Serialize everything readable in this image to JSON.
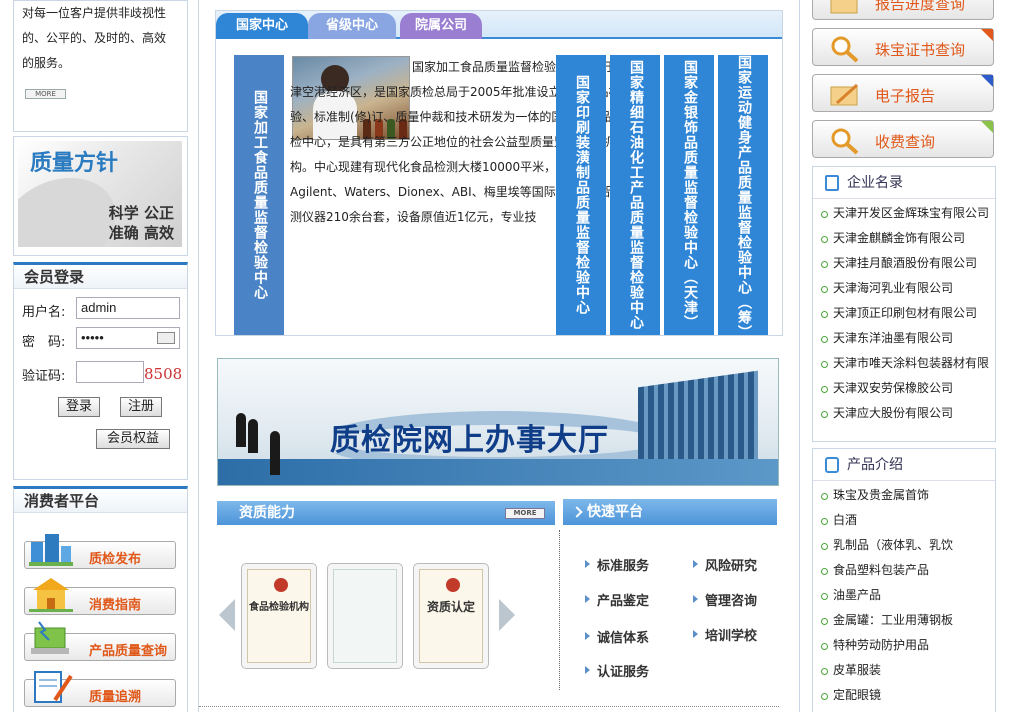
{
  "left": {
    "intro_text": "对每一位客户提供非歧视性\n的、公平的、及时的、高效\n的服务。",
    "more_label": "MORE",
    "quality": {
      "title": "质量方针",
      "slogan_line1": "科学 公正",
      "slogan_line2": "准确 高效"
    },
    "login": {
      "title": "会员登录",
      "username_label": "用户名:",
      "username_value": "admin",
      "password_label": "密　码:",
      "password_value": "•••••",
      "captcha_label": "验证码:",
      "captcha_value": "8508",
      "login_button": "登录",
      "register_button": "注册",
      "rights_button": "会员权益"
    },
    "consumer": {
      "title": "消费者平台",
      "items": [
        "质检发布",
        "消费指南",
        "产品质量查询",
        "质量追溯"
      ]
    }
  },
  "center": {
    "tabs": [
      "国家中心",
      "省级中心",
      "院属公司"
    ],
    "vertical_titles": [
      "国家加工食品质量监督检验中心",
      "国家印刷装潢制品质量监督检验中心",
      "国家精细石油化工产品质量监督检验中心",
      "国家金银饰品质量监督检验中心（天津）",
      "国家运动健身产品质量监督检验中心（筹）"
    ],
    "description": "国家加工食品质量监督检验中心坐落于天津空港经济区，是国家质检总局于2005年批准设立的集产品检验、标准制(修)订、质量仲裁和技术研发为一体的国家级食品质检中心，是具有第三方公正地位的社会公益型质量监督检验机构。中心现建有现代化食品检测大楼10000平米，拥有Agilent、Waters、Dionex、ABI、梅里埃等国际先进的食品检测仪器210余台套，设备原值近1亿元，专业技",
    "banner_text": "质检院网上办事大厅",
    "qualification": {
      "title": "资质能力",
      "more_label": "MORE",
      "certs": [
        "食品检验机构",
        "",
        "资质认定"
      ]
    },
    "quick": {
      "title": "快速平台",
      "links": [
        "标准服务",
        "风险研究",
        "产品鉴定",
        "管理咨询",
        "诚信体系",
        "培训学校",
        "认证服务"
      ]
    }
  },
  "right": {
    "buttons": [
      "报告进度查询",
      "珠宝证书查询",
      "电子报告",
      "收费查询"
    ],
    "companies": {
      "title": "企业名录",
      "items": [
        "天津开发区金辉珠宝有限公司",
        "天津金麒麟金饰有限公司",
        "天津挂月酿酒股份有限公司",
        "天津海河乳业有限公司",
        "天津顶正印刷包材有限公司",
        "天津东洋油墨有限公司",
        "天津市唯天涂料包装器材有限",
        "天津双安劳保橡胶公司",
        "天津应大股份有限公司"
      ]
    },
    "products": {
      "title": "产品介绍",
      "items": [
        "珠宝及贵金属首饰",
        "白酒",
        "乳制品（液体乳、乳饮",
        "食品塑料包装产品",
        "油墨产品",
        "金属罐：工业用薄钢板",
        "特种劳动防护用品",
        "皮革服装",
        "定配眼镜"
      ]
    },
    "corner_colors": [
      "#e0591a",
      "#2d5bc9",
      "#8bc34a"
    ]
  }
}
